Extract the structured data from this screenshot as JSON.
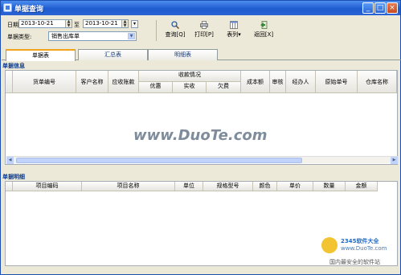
{
  "window": {
    "title": "单据查询"
  },
  "filters": {
    "date_label": "日期",
    "date_from": "2013-10-21",
    "to_label": "至",
    "date_to": "2013-10-21",
    "type_label": "单据类型:",
    "type_value": "销售出库单"
  },
  "toolbar": {
    "query": "查询[Q]",
    "print": "打印[P]",
    "columns": "表列",
    "back": "返回[X]"
  },
  "tabs": [
    {
      "label": "单据表"
    },
    {
      "label": "汇总表"
    },
    {
      "label": "明细表"
    }
  ],
  "info": {
    "section_title": "单据信息",
    "headers": {
      "doc_no": "货单编号",
      "customer": "客户名称",
      "receivable": "应收账款",
      "receipt_group": "收款情况",
      "discount": "优惠",
      "received": "实收",
      "owed": "欠费",
      "cost": "成本额",
      "audit": "审核",
      "operator": "经办人",
      "original_no": "原始单号",
      "warehouse": "仓库名称"
    }
  },
  "detail": {
    "section_title": "单据明细",
    "headers": {
      "item_code": "项目编码",
      "item_name": "项目名称",
      "unit": "单位",
      "spec": "规格型号",
      "color": "颜色",
      "price": "单价",
      "qty": "数量",
      "amount": "金额"
    }
  },
  "watermark": {
    "text": "www.DuoTe.com"
  },
  "logo": {
    "line1": "2345软件大全",
    "line2": "www.DuoTe.com",
    "line3": "国内最安全的软件站"
  }
}
